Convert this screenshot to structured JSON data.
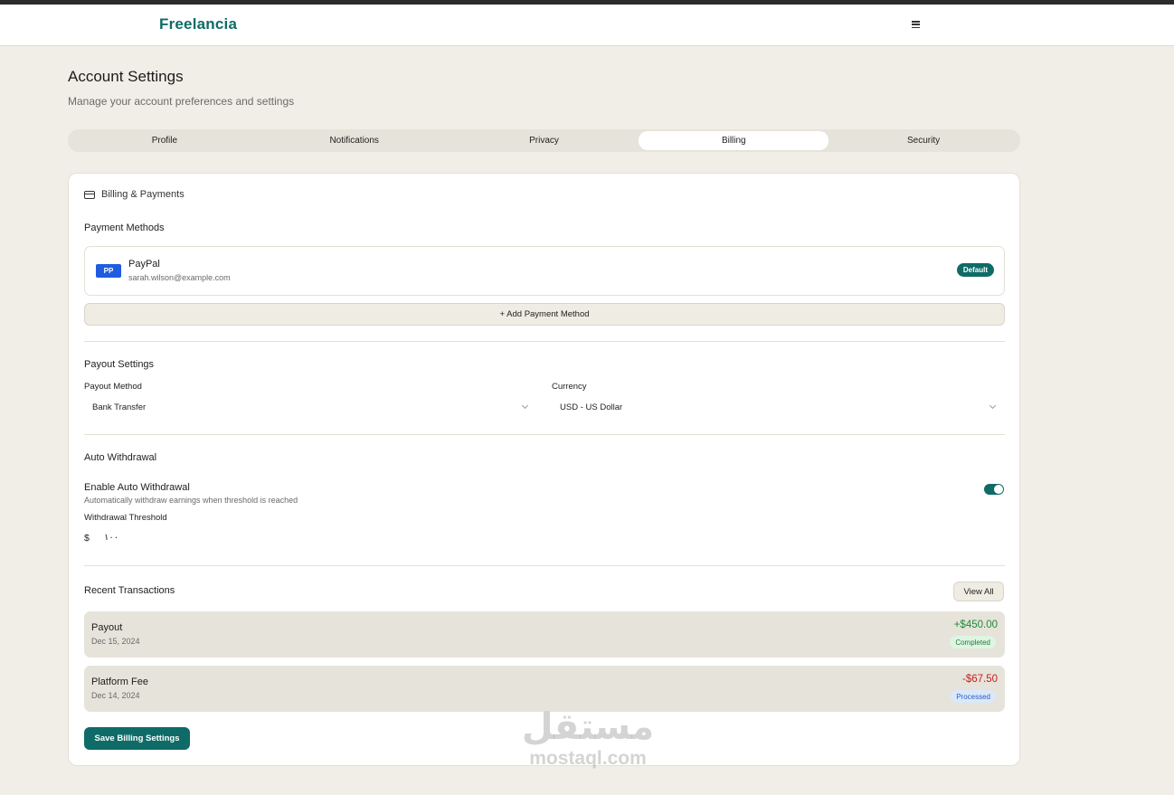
{
  "app": {
    "brand": "Freelancia"
  },
  "header": {
    "title": "Account Settings",
    "subtitle": "Manage your account preferences and settings"
  },
  "tabs": [
    {
      "label": "Profile",
      "active": false
    },
    {
      "label": "Notifications",
      "active": false
    },
    {
      "label": "Privacy",
      "active": false
    },
    {
      "label": "Billing",
      "active": true
    },
    {
      "label": "Security",
      "active": false
    }
  ],
  "billing": {
    "card_title": "Billing & Payments",
    "payment_methods": {
      "title": "Payment Methods",
      "items": [
        {
          "badge": "PP",
          "name": "PayPal",
          "email": "sarah.wilson@example.com",
          "tag": "Default"
        }
      ],
      "add_label": "+ Add Payment Method"
    },
    "payout": {
      "title": "Payout Settings",
      "method_label": "Payout Method",
      "method_value": "Bank Transfer",
      "currency_label": "Currency",
      "currency_value": "USD - US Dollar"
    },
    "auto_withdrawal": {
      "title": "Auto Withdrawal",
      "enable_label": "Enable Auto Withdrawal",
      "enable_desc": "Automatically withdraw earnings when threshold is reached",
      "enabled": true,
      "threshold_label": "Withdrawal Threshold",
      "currency_symbol": "$",
      "threshold_value": "١٠٠"
    },
    "transactions": {
      "title": "Recent Transactions",
      "view_all": "View All",
      "items": [
        {
          "type": "Payout",
          "date": "Dec 15, 2024",
          "amount": "+$450.00",
          "status": "Completed"
        },
        {
          "type": "Platform Fee",
          "date": "Dec 14, 2024",
          "amount": "-$67.50",
          "status": "Processed"
        }
      ]
    },
    "save_label": "Save Billing Settings"
  },
  "colors": {
    "accent": "#0f6b68",
    "positive": "#1f8a3a",
    "negative": "#c62020",
    "completed_bg": "#dff5e3",
    "processed_bg": "#dbe8fb"
  },
  "watermark": {
    "arabic": "مستقل",
    "latin": "mostaql.com"
  }
}
